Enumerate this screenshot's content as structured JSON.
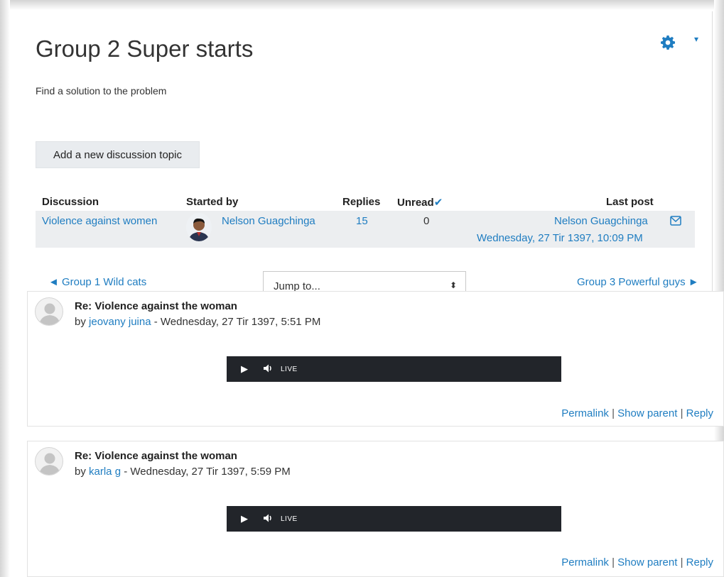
{
  "forum": {
    "title": "Group 2 Super starts",
    "intro": "Find a solution to the problem",
    "add_button": "Add a new discussion topic"
  },
  "table": {
    "headers": {
      "discussion": "Discussion",
      "started_by": "Started by",
      "replies": "Replies",
      "unread": "Unread",
      "last_post": "Last post"
    },
    "rows": [
      {
        "discussion": "Violence against women",
        "started_by": "Nelson Guagchinga",
        "replies": "15",
        "unread": "0",
        "last_post_author": "Nelson Guagchinga",
        "last_post_date": "Wednesday, 27 Tir 1397, 10:09 PM"
      }
    ]
  },
  "navigation": {
    "prev": "◄ Group 1 Wild cats",
    "jump_placeholder": "Jump to...",
    "next": "Group 3 Powerful guys ►"
  },
  "posts": [
    {
      "subject": "Re: Violence against the woman",
      "by_prefix": "by ",
      "author": "jeovany juina",
      "date": " - Wednesday, 27 Tir 1397, 5:51 PM",
      "player_label": "LIVE"
    },
    {
      "subject": "Re: Violence against the woman",
      "by_prefix": "by ",
      "author": "karla g",
      "date": " - Wednesday, 27 Tir 1397, 5:59 PM",
      "player_label": "LIVE"
    }
  ],
  "post_actions": {
    "permalink": "Permalink",
    "show_parent": "Show parent",
    "reply": "Reply",
    "separator": "|"
  },
  "colors": {
    "link": "#1f7dc1",
    "player": "#22252a",
    "row_bg": "#eceef0",
    "button_bg": "#e9ecef"
  }
}
